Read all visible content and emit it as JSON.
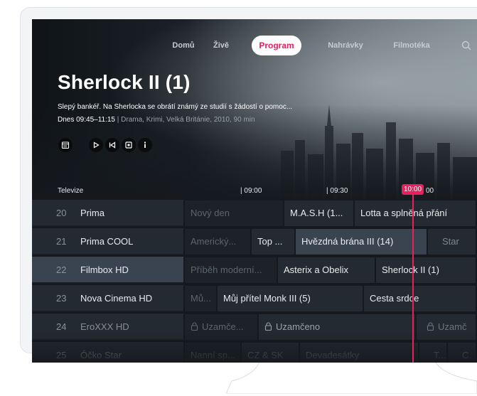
{
  "nav": {
    "items": [
      "Domů",
      "Živě",
      "Program",
      "Nahrávky",
      "Filmotéka"
    ],
    "active": "Program",
    "search_icon": "search-icon"
  },
  "hero": {
    "title": "Sherlock II (1)",
    "description": "Slepý bankéř. Na Sherlocka se obrátí známý ze studií s žádostí o pomoc...",
    "time": "Dnes 09:45–11:15",
    "meta": " | Drama, Krimi, Velká Británie, 2010, 90 min",
    "controls": [
      "calendar-icon",
      "play-icon",
      "restart-icon",
      "record-icon",
      "info-icon"
    ]
  },
  "timeline": {
    "label": "Televize",
    "ticks": [
      "| 09:00",
      "| 09:30",
      "10:00"
    ],
    "partial_tick": "00",
    "now": "10:00"
  },
  "channels": [
    {
      "num": "20",
      "name": "Prima"
    },
    {
      "num": "21",
      "name": "Prima COOL"
    },
    {
      "num": "22",
      "name": "Filmbox HD"
    },
    {
      "num": "23",
      "name": "Nova Cinema HD"
    },
    {
      "num": "24",
      "name": "EroXXX HD"
    },
    {
      "num": "25",
      "name": "Óčko Star"
    }
  ],
  "programs": {
    "r20": [
      "Nový den",
      "M.A.S.H (1...",
      "Lotta a splněná přání"
    ],
    "r21": [
      "Americký...",
      "Top ...",
      "Hvězdná brána III (14)",
      "Star"
    ],
    "r22": [
      "Příběh moderní...",
      "Asterix a Obelix",
      "Sherlock II (1)"
    ],
    "r23": [
      "Mů...",
      "Můj přítel Monk III (5)",
      "Cesta srdce"
    ],
    "r24": [
      "Uzamče...",
      "Uzamčeno",
      "Uzamč"
    ],
    "r25": [
      "Nanní sp...",
      "CZ & SK",
      "Devadesátky",
      "T...",
      "C"
    ]
  },
  "colors": {
    "accent": "#e6215d",
    "background": "#15191e",
    "cell": "#232a31",
    "selected": "#3a4450"
  }
}
